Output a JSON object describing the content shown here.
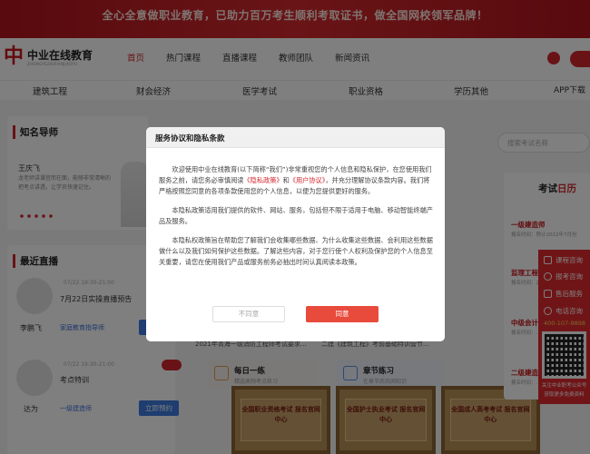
{
  "banner": {
    "text": "全心全意做职业教育，已助力百万考生顺利考取证书，做全国网校领军品牌！"
  },
  "header": {
    "logo_name": "中业在线教育",
    "logo_sub": "ZHONGYEZAIXIANJIAOYU",
    "nav": [
      "首页",
      "热门课程",
      "直播课程",
      "教师团队",
      "新闻资讯"
    ]
  },
  "categories": [
    "建筑工程",
    "财会经济",
    "医学考试",
    "职业资格",
    "学历其他",
    "APP下载"
  ],
  "teachers": {
    "title": "知名导师",
    "name": "王庆飞",
    "desc": "龙老师讲课宫而在面，能够非常清晰的把考点讲透，让学员快速记住。"
  },
  "live": {
    "title": "最近直播",
    "items": [
      {
        "person": "李鹏飞",
        "time": "07/22 19:30-21:00",
        "topic": "7月22日实操直播预告",
        "link": "家庭教育指导师",
        "button": ""
      },
      {
        "person": "达为",
        "time": "07/22 19:30-21:00",
        "topic": "考点特训",
        "link": "一级建造师",
        "button": "立即预约"
      }
    ]
  },
  "middle": {
    "strip_left": "2021年青海一级消防工程师考试要求…",
    "strip_right": "二建《建筑工程》考前基础特训营节…",
    "cards": [
      {
        "title": "每日一练",
        "sub": "精选高频考点练习"
      },
      {
        "title": "章节练习",
        "sub": "在章节后巩固知识"
      }
    ],
    "certs": [
      "全国职业资格考试 报名官网中心",
      "全国护士执业考试 报名官网中心",
      "全国成人高考考试 报名官网中心"
    ]
  },
  "search": {
    "placeholder": "搜索考试名称"
  },
  "exam": {
    "title_prefix": "考试",
    "title_accent": "日历",
    "items": [
      {
        "name": "一级建造师",
        "note": "报名时间：预计2022年7月份"
      },
      {
        "name": "监理工程师",
        "note": "报名时间：2022年…"
      },
      {
        "name": "中级会计",
        "note": "报名时间：…"
      },
      {
        "name": "二级建造师",
        "note": "报名时间：…"
      }
    ]
  },
  "float_widget": {
    "items": [
      "课程咨询",
      "报考咨询",
      "售后服务",
      "电话咨询"
    ],
    "phone": "400-107-9898",
    "caption1": "关注中业职考公众号",
    "caption2": "获取更多免费资料"
  },
  "modal": {
    "title": "服务协议和隐私条款",
    "p1_before": "欢迎使用中业在线教育(以下简称“我们”)非常重视您的个人信息和隐私保护，在您使用我们服务之前，请您务必审慎阅读",
    "privacy_link": "《隐私政策》",
    "p1_and": "和",
    "user_link": "《用户协议》",
    "p1_after": "，并充分理解协议条款内容。我们将严格按照您同意的各项条款使用您的个人信息，以便为您提供更好的服务。",
    "p2": "本隐私政策适用我们提供的软件、网站、服务，包括但不限于适用于电脑、移动智能终端产品及服务。",
    "p3": "本隐私权政策旨在帮助您了解我们会收集哪些数据、为什么收集这些数据、会利用这些数据做什么以及我们如何保护这些数据。了解这些内容，对于您行使个人权利及保护您的个人信息至关重要，请您在使用我们产品或服务前务必抽出时间认真阅读本政策。",
    "disagree": "不同意",
    "agree": "同意"
  }
}
